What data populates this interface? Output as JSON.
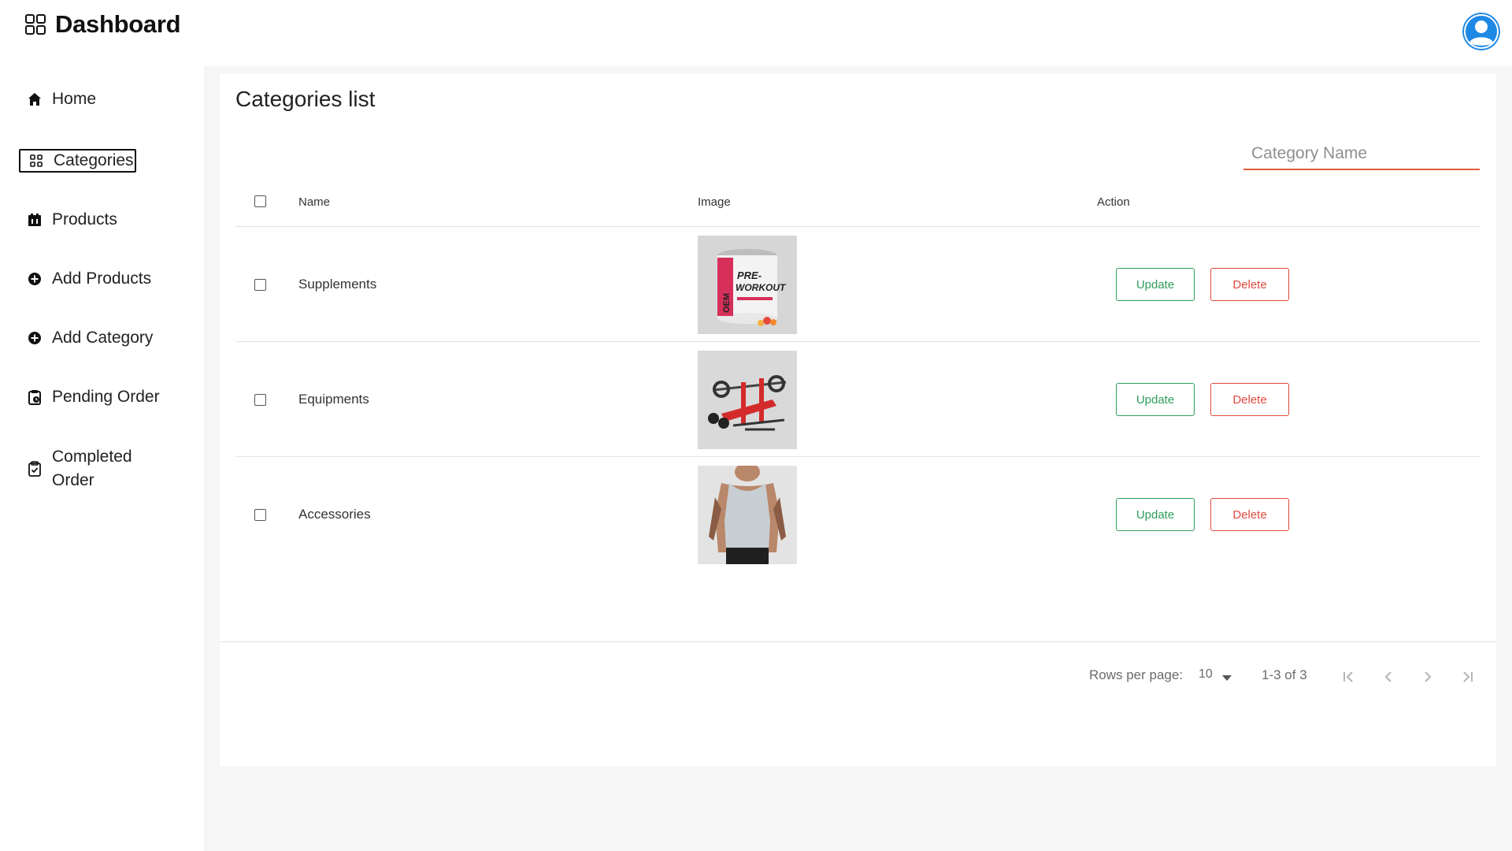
{
  "app": {
    "title": "Dashboard",
    "grid_icon": "grid-icon",
    "avatar_icon": "user-avatar-icon",
    "accent": "#e35a3c"
  },
  "sidebar": {
    "items": [
      {
        "label": "Home",
        "icon": "home-icon"
      },
      {
        "label": "Categories",
        "icon": "grid-icon",
        "active": true
      },
      {
        "label": "Products",
        "icon": "box-icon"
      },
      {
        "label": "Add Products",
        "icon": "plus-circle-icon"
      },
      {
        "label": "Add Category",
        "icon": "plus-circle-icon"
      },
      {
        "label": "Pending Order",
        "icon": "clipboard-pending-icon"
      },
      {
        "label": "Completed Order",
        "icon": "clipboard-check-icon"
      }
    ]
  },
  "main": {
    "title": "Categories list",
    "search": {
      "placeholder": "Category Name",
      "value": ""
    },
    "table": {
      "columns": [
        "Name",
        "Image",
        "Action"
      ],
      "rows": [
        {
          "name": "Supplements",
          "image": "pre-workout-tub",
          "update_label": "Update",
          "delete_label": "Delete"
        },
        {
          "name": "Equipments",
          "image": "weight-bench",
          "update_label": "Update",
          "delete_label": "Delete"
        },
        {
          "name": "Accessories",
          "image": "tank-top-model",
          "update_label": "Update",
          "delete_label": "Delete"
        }
      ]
    },
    "pagination": {
      "rows_per_page_label": "Rows per page:",
      "rows_per_page": "10",
      "range": "1-3 of 3"
    }
  },
  "product_text": {
    "pre": "PRE-",
    "workout": "WORKOUT",
    "brand": "OEM"
  },
  "colors": {
    "update": "#2e9e5b",
    "delete": "#e04a3f",
    "avatar": "#1e88e5"
  }
}
